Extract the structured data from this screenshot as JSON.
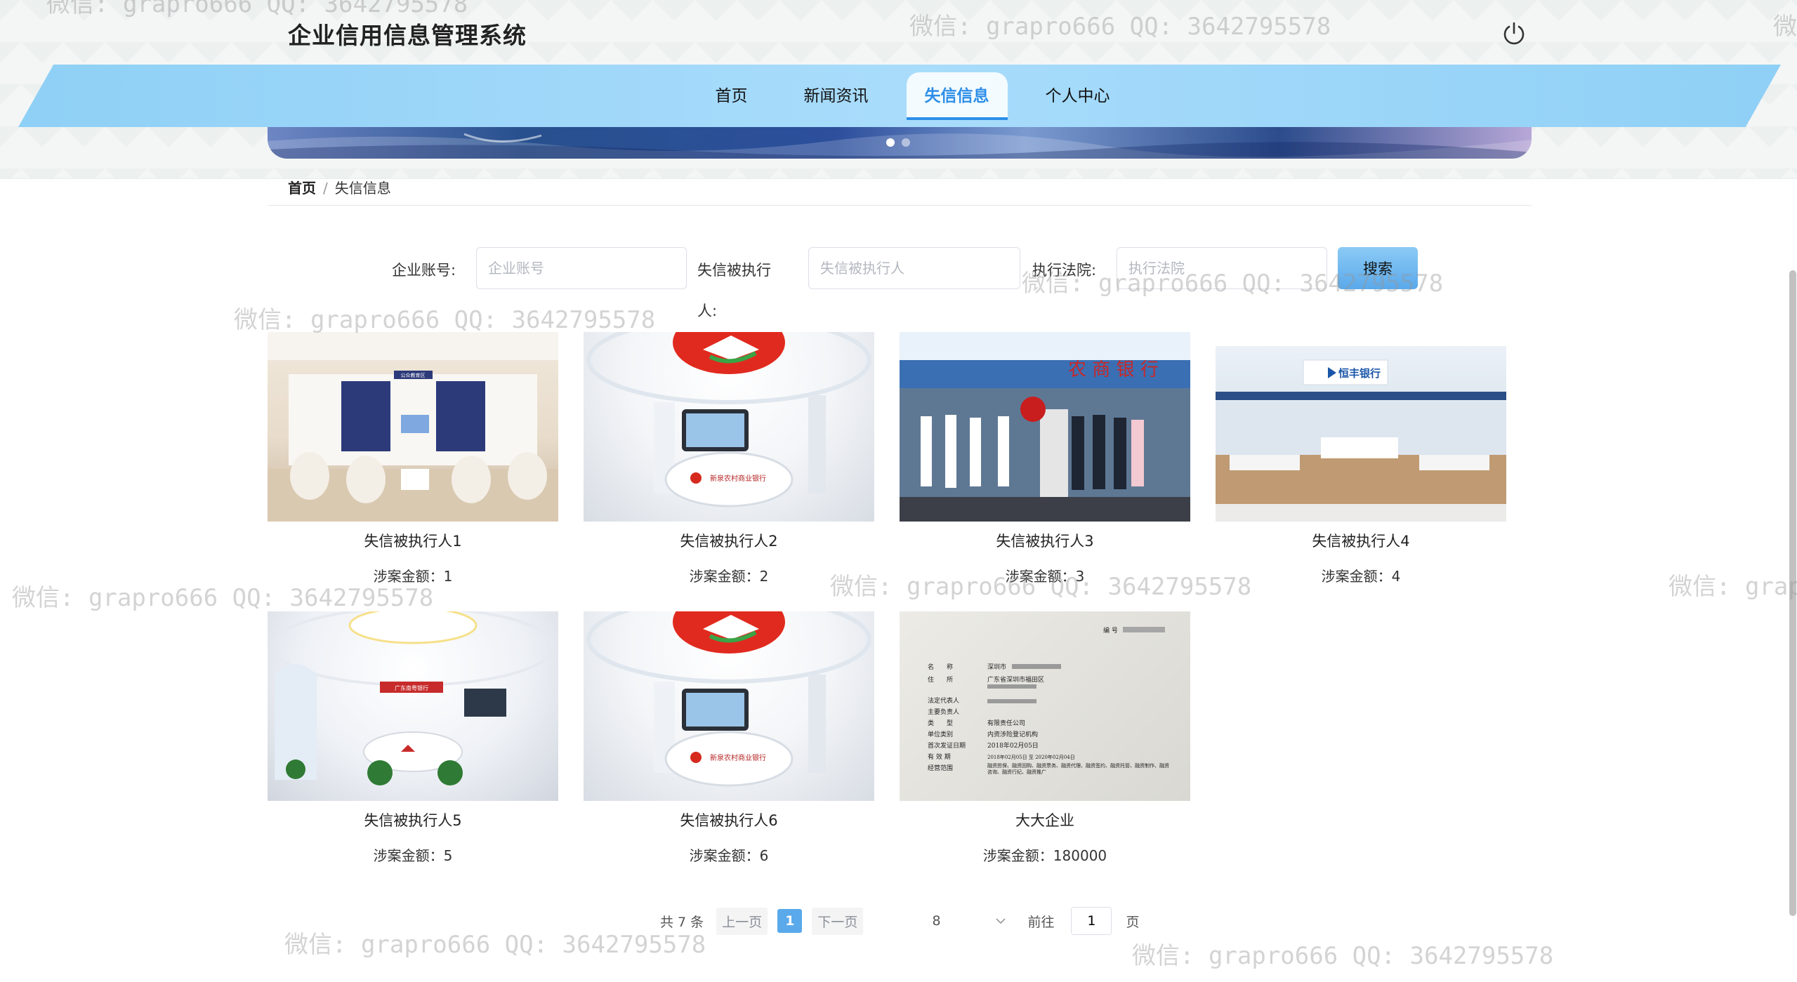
{
  "header": {
    "site_title": "企业信用信息管理系统",
    "power_icon": "power-icon"
  },
  "nav": {
    "items": [
      {
        "label": "首页",
        "active": false
      },
      {
        "label": "新闻资讯",
        "active": false
      },
      {
        "label": "失信信息",
        "active": true
      },
      {
        "label": "个人中心",
        "active": false
      }
    ]
  },
  "breadcrumb": {
    "home": "首页",
    "separator": "/",
    "current": "失信信息"
  },
  "search": {
    "account_label": "企业账号:",
    "account_placeholder": "企业账号",
    "executed_label_line1": "失信被执行",
    "executed_label_line2": "人:",
    "executed_placeholder": "失信被执行人",
    "court_label": "执行法院:",
    "court_placeholder": "执行法院",
    "button": "搜索"
  },
  "cards": [
    {
      "name": "失信被执行人1",
      "amount": "涉案金额：1"
    },
    {
      "name": "失信被执行人2",
      "amount": "涉案金额：2"
    },
    {
      "name": "失信被执行人3",
      "amount": "涉案金额：3"
    },
    {
      "name": "失信被执行人4",
      "amount": "涉案金额：4"
    },
    {
      "name": "失信被执行人5",
      "amount": "涉案金额：5"
    },
    {
      "name": "失信被执行人6",
      "amount": "涉案金额：6"
    },
    {
      "name": "大大企业",
      "amount": "涉案金额：180000"
    }
  ],
  "image_text": {
    "bank1_sign": "公众教育区",
    "bank2_sign": "新泉农村商业银行",
    "bank3_sign": "农 商 银 行",
    "bank4_sign": "恒丰银行",
    "bank5_sign": "广东南粤银行",
    "license_no": "编 号",
    "license_rows": [
      {
        "k": "名　　称",
        "v": "深圳市"
      },
      {
        "k": "住　　所",
        "v": "广东省深圳市福田区"
      },
      {
        "k": "法定代表人",
        "v": ""
      },
      {
        "k": "主要负责人",
        "v": ""
      },
      {
        "k": "类　　型",
        "v": "有限责任公司"
      },
      {
        "k": "单位类别",
        "v": "内资涉险登记机构"
      },
      {
        "k": "首次发证日期",
        "v": "2018年02月05日"
      },
      {
        "k": "有 效 期",
        "v": "2018年02月05日 至 2020年02月04日"
      },
      {
        "k": "经营范围",
        "v": "融资担保、融资回购、融资票务、融资代理、融资签约、融资托管、融资制作、融资咨询、融资行纪、融资推广"
      }
    ]
  },
  "pagination": {
    "total": "共 7 条",
    "prev": "上一页",
    "current": "1",
    "next": "下一页",
    "page_size": "8",
    "goto_label": "前往",
    "goto_value": "1",
    "page_suffix": "页"
  },
  "watermark": "微信: grapro666 QQ: 3642795578"
}
